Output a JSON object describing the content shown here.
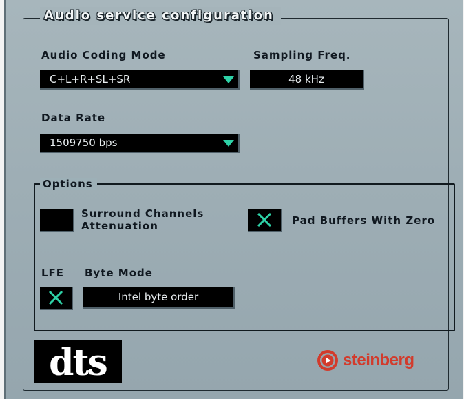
{
  "title": "Audio service configuration",
  "audio_coding_mode": {
    "label": "Audio Coding Mode",
    "value": "C+L+R+SL+SR"
  },
  "sampling_freq": {
    "label": "Sampling Freq.",
    "value": "48 kHz"
  },
  "data_rate": {
    "label": "Data Rate",
    "value": "1509750 bps"
  },
  "options": {
    "title": "Options",
    "surround_attenuation": {
      "label_line1": "Surround Channels",
      "label_line2": "Attenuation",
      "checked": false
    },
    "pad_buffers": {
      "label": "Pad Buffers With Zero",
      "checked": true
    },
    "lfe": {
      "label": "LFE",
      "checked": true
    },
    "byte_mode": {
      "label": "Byte Mode",
      "value": "Intel byte order"
    }
  },
  "logos": {
    "dts": "dts",
    "steinberg": "steinberg"
  },
  "colors": {
    "accent": "#2ed2a7",
    "panel": "#a0b0b6",
    "steinberg_red": "#d23b2c"
  }
}
